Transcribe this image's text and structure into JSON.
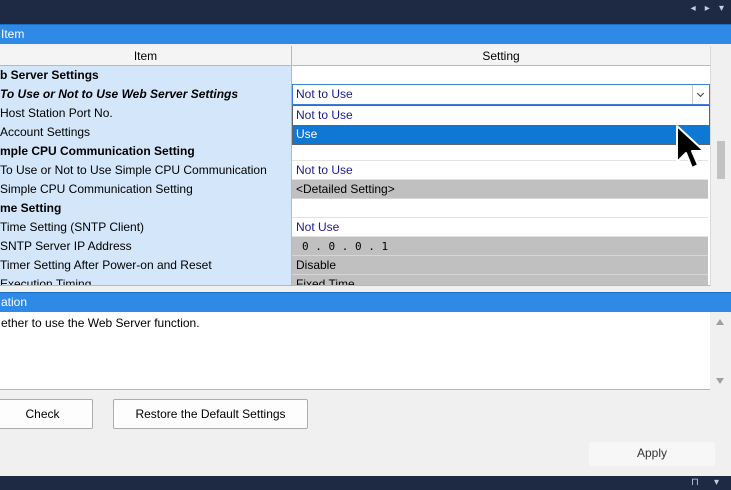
{
  "top_bar": {
    "nav_glyphs": "◂ ▸ ▾"
  },
  "item_panel": {
    "header": "Item"
  },
  "grid": {
    "columns": {
      "item": "Item",
      "setting": "Setting"
    },
    "rows": [
      {
        "item": "b Server Settings",
        "setting": ""
      },
      {
        "item": "To Use or Not to Use Web Server Settings",
        "setting": ""
      },
      {
        "item": "Host Station Port No.",
        "setting": ""
      },
      {
        "item": "Account Settings",
        "setting": ""
      },
      {
        "item": "mple CPU Communication Setting",
        "setting": ""
      },
      {
        "item": "To Use or Not to Use Simple CPU Communication",
        "setting": "Not to Use"
      },
      {
        "item": "Simple CPU Communication Setting",
        "setting": "<Detailed Setting>"
      },
      {
        "item": "me Setting",
        "setting": ""
      },
      {
        "item": "Time Setting (SNTP Client)",
        "setting": "Not Use"
      },
      {
        "item": "SNTP Server IP Address",
        "setting": "0 . 0 . 0 . 1"
      },
      {
        "item": "Timer Setting After Power-on and Reset",
        "setting": "Disable"
      },
      {
        "item": "Execution Timing",
        "setting": "Fixed Time"
      }
    ],
    "dropdown": {
      "value": "Not to Use",
      "options": [
        "Not to Use",
        "Use"
      ],
      "selected": "Use"
    }
  },
  "explanation": {
    "header": "ation",
    "text": "ether to use the Web Server function."
  },
  "buttons": {
    "check": "Check",
    "restore": "Restore the Default Settings",
    "apply": "Apply"
  },
  "bottom_bar": {
    "glyphs": "⊓ ▾"
  },
  "colors": {
    "header_blue": "#2e8ae6",
    "item_bg": "#d4e6f9",
    "selection": "#0f78d4",
    "frame": "#1e2a44"
  }
}
